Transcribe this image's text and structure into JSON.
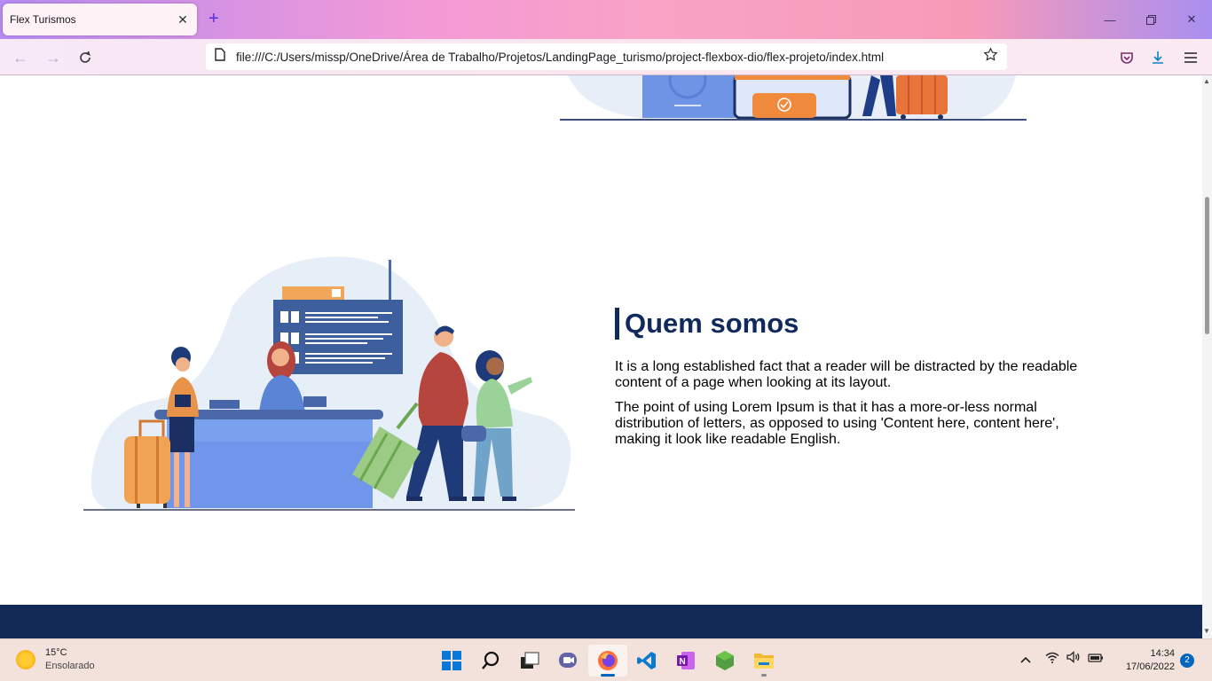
{
  "browser": {
    "tab_title": "Flex Turismos",
    "url": "file:///C:/Users/missp/OneDrive/Área de Trabalho/Projetos/LandingPage_turismo/project-flexbox-dio/flex-projeto/index.html"
  },
  "content": {
    "heading": "Quem somos",
    "paragraph_1": "It is a long established fact that a reader will be distracted by the readable content of a page when looking at its layout.",
    "paragraph_2": "The point of using Lorem Ipsum is that it has a more-or-less normal distribution of letters, as opposed to using 'Content here, content here', making it look like readable English."
  },
  "colors": {
    "heading": "#102a5c",
    "footer": "#132a57",
    "accent_orange": "#f08a3c",
    "blob": "#e6eef8"
  },
  "taskbar": {
    "weather_temp": "15°C",
    "weather_desc": "Ensolarado",
    "time": "14:34",
    "date": "17/06/2022",
    "notifications": "2",
    "apps": [
      "windows-start-icon",
      "search-icon",
      "task-view-icon",
      "teams-chat-icon",
      "firefox-icon",
      "vscode-icon",
      "onenote-icon",
      "nodejs-icon",
      "file-explorer-icon"
    ]
  }
}
